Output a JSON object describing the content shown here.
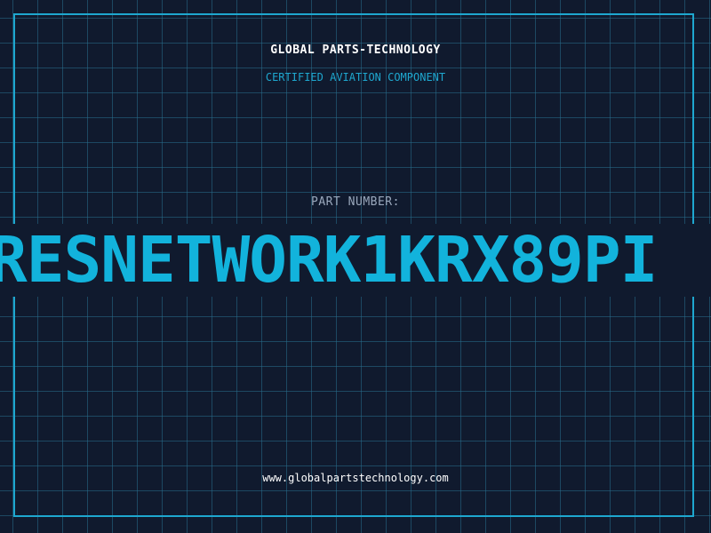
{
  "header": {
    "company": "GLOBAL PARTS-TECHNOLOGY",
    "subtitle": "CERTIFIED AVIATION COMPONENT"
  },
  "part": {
    "label": "PART NUMBER:",
    "number": "RESNETWORK1KRX89PI"
  },
  "footer": {
    "url": "www.globalpartstechnology.com"
  },
  "colors": {
    "background": "#101a2e",
    "grid": "#286e8c",
    "accent": "#1ea7cf",
    "part_number": "#12b3dc",
    "label": "#9aa8bc",
    "text": "#ffffff"
  }
}
